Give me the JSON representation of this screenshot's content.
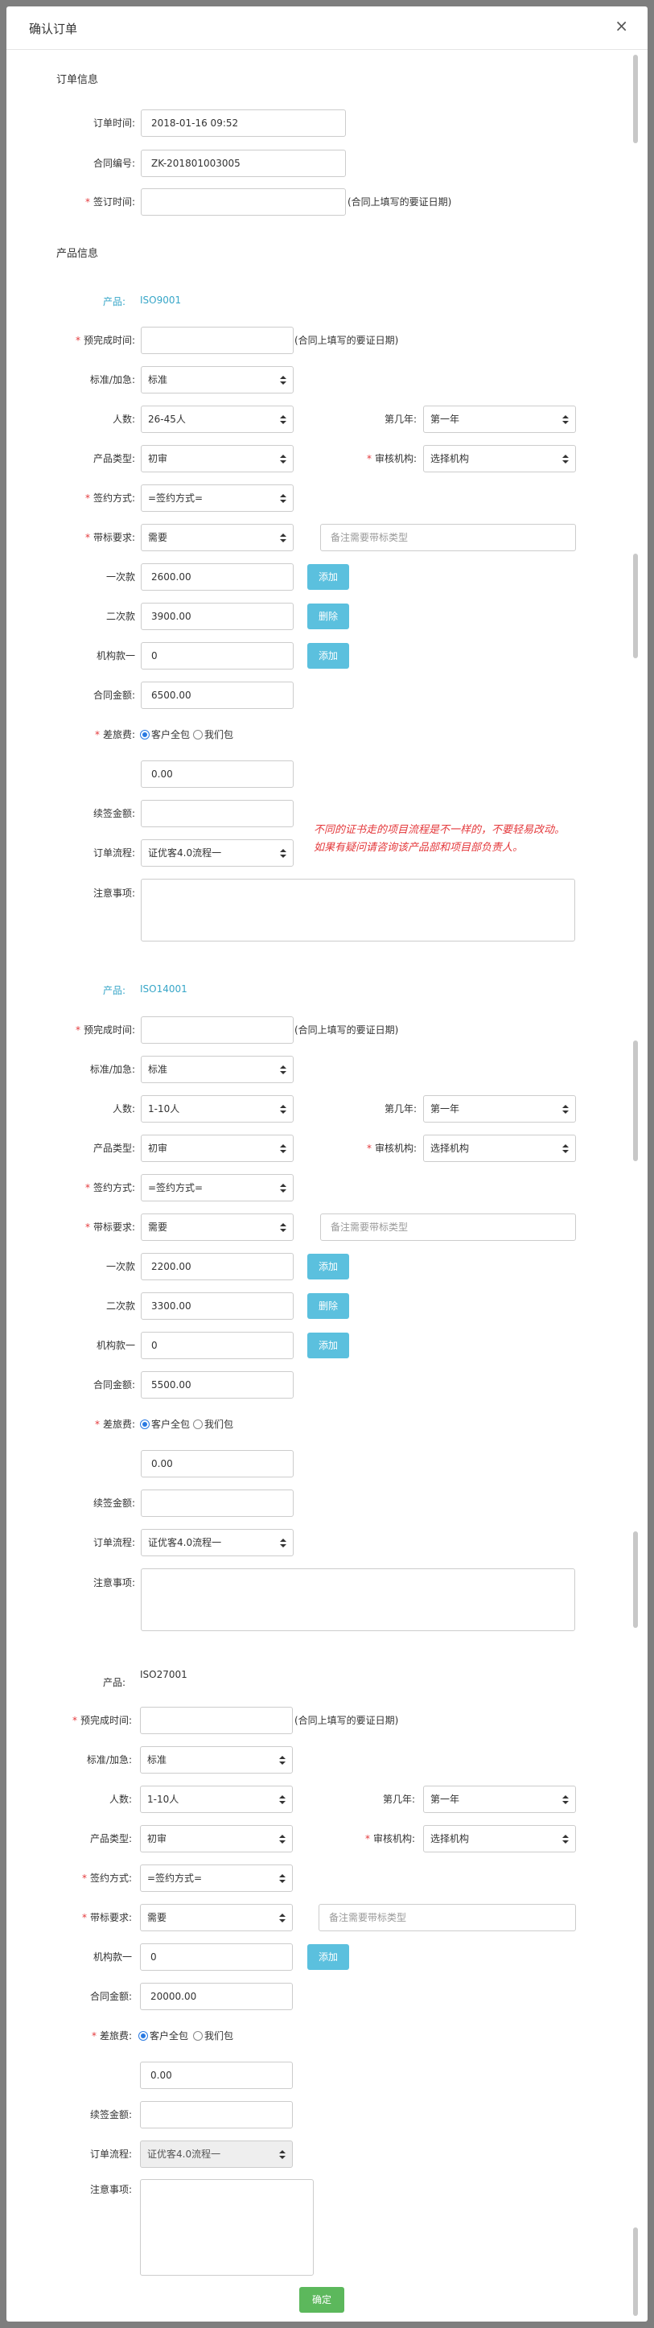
{
  "dialog": {
    "title": "确认订单",
    "close": "×"
  },
  "order": {
    "section": "订单信息",
    "time_label": "订单时间:",
    "time_value": "2018-01-16 09:52",
    "contract_label": "合同编号:",
    "contract_value": "ZK-201801003005",
    "sign_label": "签订时间:",
    "sign_hint": "(合同上填写的要证日期)"
  },
  "product_section": "产品信息",
  "labels": {
    "product": "产品:",
    "finish": "预完成时间:",
    "finish_hint": "(合同上填写的要证日期)",
    "standard": "标准/加急:",
    "people": "人数:",
    "year": "第几年:",
    "ptype": "产品类型:",
    "org": "审核机构:",
    "sign_way": "签约方式:",
    "mark": "带标要求:",
    "mark_placeholder": "备注需要带标类型",
    "pay1": "一次款",
    "pay2": "二次款",
    "orgpay": "机构款一",
    "amount": "合同金额:",
    "travel": "差旅费:",
    "travel_opt1": "客户全包",
    "travel_opt2": "我们包",
    "renew": "续签金额:",
    "flow": "订单流程:",
    "notes": "注意事项:",
    "add": "添加",
    "del": "删除"
  },
  "products": [
    {
      "name": "ISO9001",
      "standard": "标准",
      "people": "26-45人",
      "year": "第一年",
      "ptype": "初审",
      "org": "选择机构",
      "sign_way": "=签约方式=",
      "mark": "需要",
      "pay1": "2600.00",
      "pay2": "3900.00",
      "orgpay": "0",
      "amount": "6500.00",
      "travel_amount": "0.00",
      "flow": "证优客4.0流程一"
    },
    {
      "name": "ISO14001",
      "standard": "标准",
      "people": "1-10人",
      "year": "第一年",
      "ptype": "初审",
      "org": "选择机构",
      "sign_way": "=签约方式=",
      "mark": "需要",
      "pay1": "2200.00",
      "pay2": "3300.00",
      "orgpay": "0",
      "amount": "5500.00",
      "travel_amount": "0.00",
      "flow": "证优客4.0流程一"
    },
    {
      "name": "ISO27001",
      "standard": "标准",
      "people": "1-10人",
      "year": "第一年",
      "ptype": "初审",
      "org": "选择机构",
      "sign_way": "=签约方式=",
      "mark": "需要",
      "orgpay": "0",
      "amount": "20000.00",
      "travel_amount": "0.00",
      "flow": "证优客4.0流程一"
    }
  ],
  "annotation": {
    "line1": "不同的证书走的项目流程是不一样的，不要轻易改动。",
    "line2": "如果有疑问请咨询该产品部和项目部负责人。"
  },
  "confirm_label": "确定",
  "colors": {
    "accent": "#5bc0de",
    "confirm": "#5cb85c",
    "required": "#e4393c",
    "product_link": "#37a6c8"
  }
}
